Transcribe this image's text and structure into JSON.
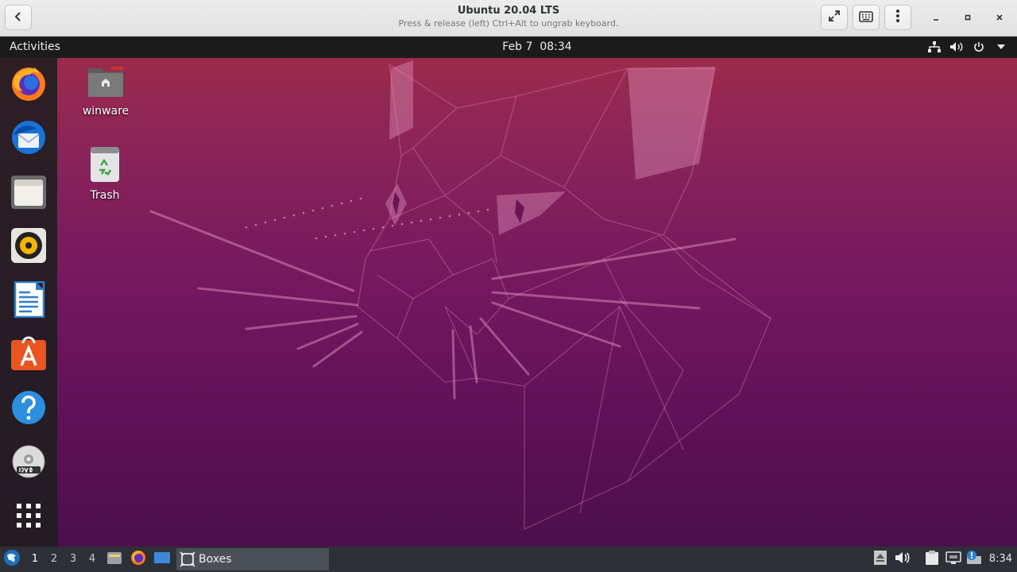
{
  "host_window": {
    "title": "Ubuntu 20.04 LTS",
    "subtitle": "Press & release (left) Ctrl+Alt to ungrab keyboard.",
    "buttons": {
      "back_icon": "chevron-left-icon",
      "fullscreen_icon": "fullscreen-icon",
      "keyboard_icon": "keyboard-icon",
      "menu_icon": "kebab-menu-icon",
      "minimize_icon": "minimize-icon",
      "maximize_icon": "maximize-icon",
      "close_icon": "close-icon"
    }
  },
  "guest": {
    "topbar": {
      "activities": "Activities",
      "date": "Feb 7",
      "time": "08:34",
      "tray_icons": [
        "network-icon",
        "volume-icon",
        "power-icon",
        "dropdown-arrow-icon"
      ]
    },
    "dock": {
      "items": [
        {
          "name": "firefox",
          "icon": "firefox-icon"
        },
        {
          "name": "thunderbird",
          "icon": "thunderbird-icon"
        },
        {
          "name": "files",
          "icon": "files-icon"
        },
        {
          "name": "rhythmbox",
          "icon": "rhythmbox-icon"
        },
        {
          "name": "libreoffice-writer",
          "icon": "writer-icon"
        },
        {
          "name": "ubuntu-software",
          "icon": "software-icon"
        },
        {
          "name": "help",
          "icon": "help-icon"
        },
        {
          "name": "dvd",
          "icon": "dvd-icon"
        },
        {
          "name": "show-applications",
          "icon": "app-grid-icon"
        }
      ]
    },
    "desktop": {
      "icons": [
        {
          "label": "winware",
          "icon": "home-folder-icon"
        },
        {
          "label": "Trash",
          "icon": "trash-icon"
        }
      ]
    },
    "colors": {
      "wallpaper_top": "#a02c49",
      "wallpaper_bottom": "#4d0f4b",
      "topbar": "#1b1b1b",
      "dock": "#1e1e1e"
    }
  },
  "host_panel": {
    "workspaces": [
      "1",
      "2",
      "3",
      "4"
    ],
    "active_workspace": "1",
    "taskbar": {
      "label": "Boxes"
    },
    "clock": "8:34"
  }
}
